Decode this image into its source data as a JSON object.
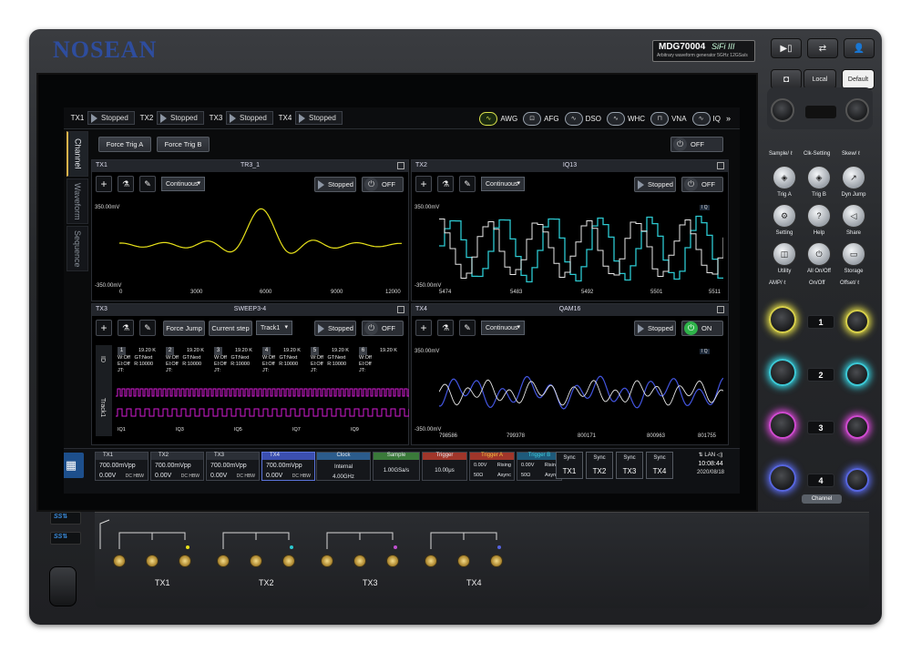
{
  "brand": {
    "logo": "NOSEAN",
    "model": "MDG70004",
    "series": "SiFi III",
    "subtitle": "Arbitrary waveform generator  5GHz 12GSa/s"
  },
  "hw_top": {
    "local": "Local",
    "default": "Default"
  },
  "topbar": {
    "channels": [
      {
        "label": "TX1",
        "status": "Stopped"
      },
      {
        "label": "TX2",
        "status": "Stopped"
      },
      {
        "label": "TX3",
        "status": "Stopped"
      },
      {
        "label": "TX4",
        "status": "Stopped"
      }
    ],
    "modes": [
      "AWG",
      "AFG",
      "DSO",
      "WHC",
      "VNA",
      "IQ"
    ],
    "active_mode": "AWG"
  },
  "sidetabs": [
    "Channel",
    "Waveform",
    "Sequence"
  ],
  "controls": {
    "force_trig_a": "Force Trig A",
    "force_trig_b": "Force Trig B",
    "global_power": "OFF"
  },
  "panels": {
    "tx1": {
      "ch": "TX1",
      "name": "TR3_1",
      "mode": "Continuous",
      "run": "Stopped",
      "power": "OFF",
      "ytop": "350.00mV",
      "ybot": "-350.00mV",
      "xticks": [
        "0",
        "3000",
        "6000",
        "9000",
        "12000"
      ],
      "color": "#e8e21a"
    },
    "tx2": {
      "ch": "TX2",
      "name": "IQ13",
      "mode": "Continuous",
      "run": "Stopped",
      "power": "OFF",
      "ytop": "350.00mV",
      "ybot": "-350.00mV",
      "xticks": [
        "5474",
        "5483",
        "5492",
        "5501",
        "5511"
      ],
      "legend": "I Q"
    },
    "tx3": {
      "ch": "TX3",
      "name": "SWEEP3-4",
      "force_jump": "Force Jump",
      "current_step": "Current step",
      "track": "Track1",
      "run": "Stopped",
      "power": "OFF",
      "seq_side_top": "ID",
      "seq_side_bottom": "Track1",
      "steps": [
        {
          "n": "1",
          "a": "19.20 K",
          "b": "W:Off",
          "c": "GT:Next",
          "d": "El:Off",
          "e": "R:10000",
          "f": "JT:"
        },
        {
          "n": "2",
          "a": "19.20 K",
          "b": "W:Off",
          "c": "GT:Next",
          "d": "El:Off",
          "e": "R:10000",
          "f": "JT:"
        },
        {
          "n": "3",
          "a": "19.20 K",
          "b": "W:Off",
          "c": "GT:Next",
          "d": "El:Off",
          "e": "R:10000",
          "f": "JT:"
        },
        {
          "n": "4",
          "a": "19.20 K",
          "b": "W:Off",
          "c": "GT:Next",
          "d": "El:Off",
          "e": "R:10000",
          "f": "JT:"
        },
        {
          "n": "5",
          "a": "19.20 K",
          "b": "W:Off",
          "c": "GT:Next",
          "d": "El:Off",
          "e": "R:10000",
          "f": "JT:"
        },
        {
          "n": "6",
          "a": "19.20 K",
          "b": "W:Off",
          "c": "",
          "d": "El:Off",
          "e": "",
          "f": "JT:"
        }
      ],
      "track_labels": [
        "IQ1",
        "IQ3",
        "IQ5",
        "IQ7",
        "IQ9"
      ]
    },
    "tx4": {
      "ch": "TX4",
      "name": "QAM16",
      "mode": "Continuous",
      "run": "Stopped",
      "power": "ON",
      "ytop": "350.00mV",
      "ybot": "-350.00mV",
      "xticks": [
        "798586",
        "799378",
        "800171",
        "800963",
        "801755"
      ],
      "legend": "I Q"
    }
  },
  "bottom": {
    "tx_tiles": [
      {
        "label": "TX1",
        "vpp": "700.00mVpp",
        "off": "0.00V",
        "mode": "DC HBW"
      },
      {
        "label": "TX2",
        "vpp": "700.00mVpp",
        "off": "0.00V",
        "mode": "DC HBW"
      },
      {
        "label": "TX3",
        "vpp": "700.00mVpp",
        "off": "0.00V",
        "mode": "DC HBW"
      },
      {
        "label": "TX4",
        "vpp": "700.00mVpp",
        "off": "0.00V",
        "mode": "DC HBW"
      }
    ],
    "clock": {
      "label": "Clock",
      "v1": "Internal",
      "v2": "4.00GHz"
    },
    "sample": {
      "label": "Sample",
      "v1": "1.00GSa/s"
    },
    "trigger": {
      "label": "Trigger",
      "v1": "10.00μs"
    },
    "trig_a": {
      "label": "Trigger A",
      "v1": "0.00V",
      "v2": "Rising",
      "v3": "50Ω",
      "v4": "Async"
    },
    "trig_b": {
      "label": "Trigger B",
      "v1": "0.00V",
      "v2": "Rising",
      "v3": "50Ω",
      "v4": "Async"
    },
    "sync": [
      {
        "a": "Sync",
        "b": "TX1"
      },
      {
        "a": "Sync",
        "b": "TX2"
      },
      {
        "a": "Sync",
        "b": "TX3"
      },
      {
        "a": "Sync",
        "b": "TX4"
      }
    ],
    "time": "10:08:44",
    "date": "2020/08/18",
    "status_icons": "⇅ LAN ◁)"
  },
  "right": {
    "top_labels": [
      "Sample/ ℓ",
      "Clk-Setting",
      "Skew/ ℓ"
    ],
    "buttons": [
      [
        "Trig A",
        "Trig B",
        "Dyn Jump"
      ],
      [
        "Setting",
        "Help",
        "Share"
      ],
      [
        "Utility",
        "All On/Off",
        "Storage"
      ]
    ],
    "amp_labels": [
      "AMP/ ℓ",
      "On/Off",
      "Offset/ ℓ"
    ],
    "channel_keys": [
      "1",
      "2",
      "3",
      "4"
    ],
    "channel_label": "Channel"
  },
  "front": {
    "tx_labels": [
      "TX1",
      "TX2",
      "TX3",
      "TX4"
    ],
    "usb": "SS"
  }
}
